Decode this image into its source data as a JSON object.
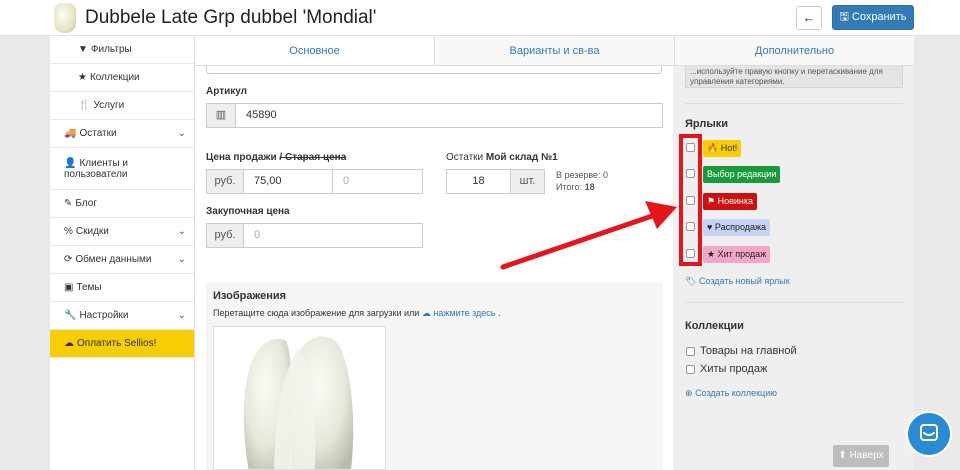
{
  "header": {
    "title": "Dubbele Late Grp dubbel 'Mondial'",
    "back_icon": "←",
    "save_label": "Сохранить",
    "save_icon": "floppy-disk-icon"
  },
  "sidebar": {
    "items": [
      {
        "label": "Фильтры",
        "icon": "▼",
        "sub": true
      },
      {
        "label": "Коллекции",
        "icon": "★",
        "sub": true
      },
      {
        "label": "Услуги",
        "icon": "🍴",
        "sub": true
      },
      {
        "label": "Остатки",
        "icon": "🚚",
        "chevron": true
      },
      {
        "label": "Клиенты и пользователи",
        "icon": "👤",
        "chevron": false
      },
      {
        "label": "Блог",
        "icon": "✎",
        "chevron": false
      },
      {
        "label": "Скидки",
        "icon": "%",
        "chevron": true
      },
      {
        "label": "Обмен данными",
        "icon": "⟳",
        "chevron": true
      },
      {
        "label": "Темы",
        "icon": "▣",
        "chevron": false
      },
      {
        "label": "Настройки",
        "icon": "🔧",
        "chevron": true
      },
      {
        "label": "Оплатить Sellios!",
        "icon": "☁",
        "active": true
      }
    ]
  },
  "tabs": [
    {
      "label": "Основное"
    },
    {
      "label": "Варианты и св-ва"
    },
    {
      "label": "Дополнительно"
    }
  ],
  "form": {
    "sku_label": "Артикул",
    "sku_value": "45890",
    "price_label": "Цена продажи",
    "old_price_label": "/ Старая цена",
    "currency": "руб.",
    "price_value": "75,00",
    "old_price_value": "0",
    "stock_label": "Остатки",
    "warehouse_label": "Мой склад №1",
    "stock_value": "18",
    "stock_unit": "шт.",
    "reserve_text": "В резерве: 0",
    "total_label": "Итого:",
    "total_value": "18",
    "purchase_label": "Закупочная цена",
    "purchase_value": "0"
  },
  "images": {
    "title": "Изображения",
    "hint": "Перетащите сюда изображение для загрузки или",
    "link": "нажмите здесь",
    "link_suffix": "."
  },
  "right": {
    "category_note": "...используйте правую кнопку и перетаскивание для управления категориями.",
    "labels_title": "Ярлыки",
    "labels": [
      {
        "text": "Hot!",
        "icon": "🔥",
        "bg": "#f7ce00",
        "fg": "#333"
      },
      {
        "text": "Выбор редакции",
        "icon": "",
        "bg": "#1a9a3c",
        "fg": "#fff"
      },
      {
        "text": "Новинка",
        "icon": "⚑",
        "bg": "#cc1111",
        "fg": "#fff"
      },
      {
        "text": "Распродажа",
        "icon": "♥",
        "bg": "#c6d3f7",
        "fg": "#222"
      },
      {
        "text": "Хит продаж",
        "icon": "★",
        "bg": "#f4a6c7",
        "fg": "#222"
      }
    ],
    "create_label": "Создать новый ярлык",
    "collections_title": "Коллекции",
    "collections": [
      "Товары на главной",
      "Хиты продаж"
    ],
    "create_collection": "Создать коллекцию"
  },
  "footer": {
    "up_label": "Наверх",
    "up_icon": "⬆"
  },
  "colors": {
    "primary": "#337ab7",
    "accent_yellow": "#f7ce00",
    "annotation_red": "#e6141b"
  }
}
